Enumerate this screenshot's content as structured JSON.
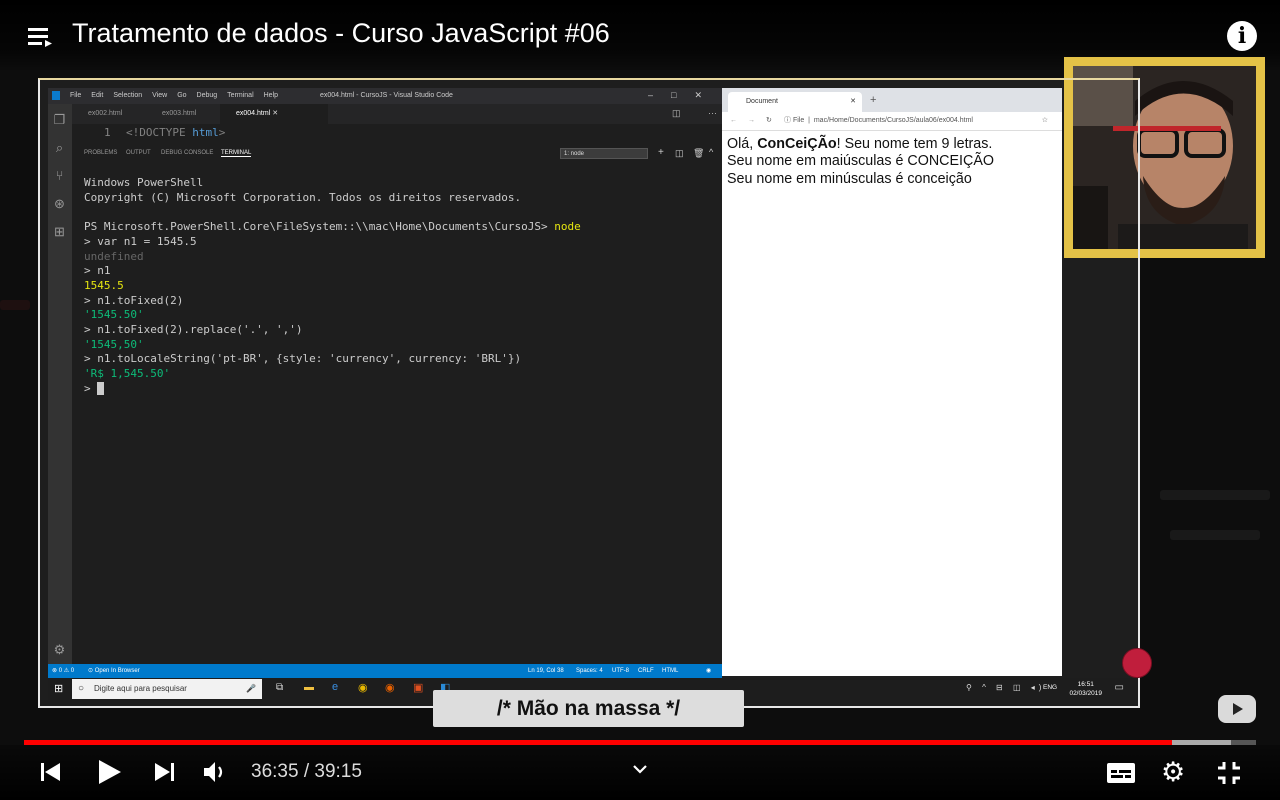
{
  "player": {
    "title": "Tratamento de dados - Curso JavaScript #06",
    "time_current": "36:35",
    "time_total": "39:15",
    "time_display": "36:35 / 39:15",
    "progress": 0.932,
    "buffered": 0.98,
    "lower_third": "/* Mão na massa */",
    "icons": [
      "playlist-icon",
      "info-icon",
      "previous-icon",
      "play-icon",
      "next-icon",
      "volume-icon",
      "chevron-down-icon",
      "subtitles-icon",
      "settings-icon",
      "exit-fullscreen-icon",
      "youtube-logo-icon"
    ]
  },
  "vscode": {
    "window_title": "ex004.html - CursoJS - Visual Studio Code",
    "menu": [
      "File",
      "Edit",
      "Selection",
      "View",
      "Go",
      "Debug",
      "Terminal",
      "Help"
    ],
    "tabs": [
      "ex002.html",
      "ex003.html",
      "ex004.html"
    ],
    "active_tab": "ex004.html",
    "editor": {
      "line_number": "1",
      "code_tag": "<!DOCTYPE",
      "code_attr": "html",
      "code_end": ">"
    },
    "panel_tabs": [
      "PROBLEMS",
      "OUTPUT",
      "DEBUG CONSOLE",
      "TERMINAL"
    ],
    "terminal_select": "1: node",
    "terminal": {
      "l1": "Windows PowerShell",
      "l2": "Copyright (C) Microsoft Corporation. Todos os direitos reservados.",
      "l3_prompt": "PS Microsoft.PowerShell.Core\\FileSystem::\\\\mac\\Home\\Documents\\CursoJS> ",
      "l3_cmd": "node",
      "l4": "> var n1 = 1545.5",
      "l5": "undefined",
      "l6": "> n1",
      "l7": "1545.5",
      "l8": "> n1.toFixed(2)",
      "l9": "'1545.50'",
      "l10": "> n1.toFixed(2).replace('.', ',')",
      "l11": "'1545,50'",
      "l12": "> n1.toLocaleString('pt-BR', {style: 'currency', currency: 'BRL'})",
      "l13": "'R$ 1,545.50'",
      "l14": "> "
    },
    "status": {
      "left": "⊗ 0 ⚠ 0",
      "open_in_browser": "Open In Browser",
      "position": "Ln 19, Col 38",
      "spaces": "Spaces: 4",
      "encoding": "UTF-8",
      "eol": "CRLF",
      "language": "HTML"
    }
  },
  "browser": {
    "tab_title": "Document",
    "address_label": "File",
    "address": "mac/Home/Documents/CursoJS/aula06/ex004.html",
    "line1_pre": "Olá, ",
    "line1_name": "ConCeiÇÃo",
    "line1_post": "! Seu nome tem 9 letras.",
    "line2": "Seu nome em maiúsculas é CONCEIÇÃO",
    "line3": "Seu nome em minúsculas é conceição"
  },
  "taskbar": {
    "search_placeholder": "Digite aqui para pesquisar",
    "lang": "ENG",
    "time": "16:51",
    "date": "02/03/2019"
  }
}
